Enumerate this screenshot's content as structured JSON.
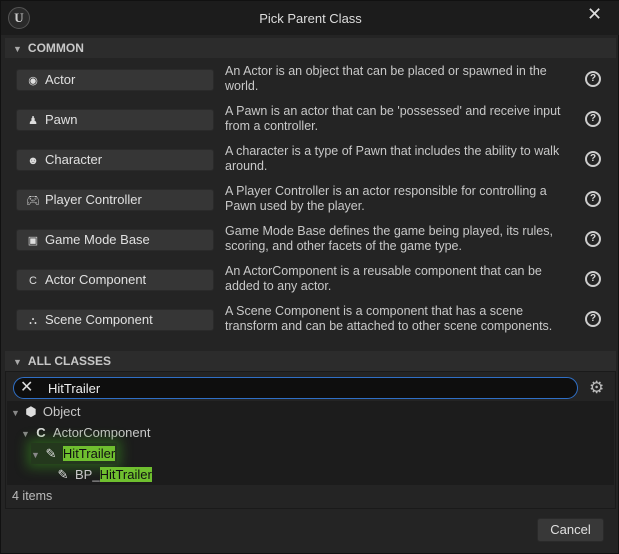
{
  "window": {
    "title": "Pick Parent Class",
    "close_icon": "close-icon",
    "logo": "unreal-logo"
  },
  "common": {
    "header": "COMMON",
    "items": [
      {
        "label": "Actor",
        "icon": "actor-icon",
        "desc": "An Actor is an object that can be placed or spawned in the world."
      },
      {
        "label": "Pawn",
        "icon": "pawn-icon",
        "desc": "A Pawn is an actor that can be 'possessed' and receive input from a controller."
      },
      {
        "label": "Character",
        "icon": "character-icon",
        "desc": "A character is a type of Pawn that includes the ability to walk around."
      },
      {
        "label": "Player Controller",
        "icon": "gamepad-icon",
        "desc": "A Player Controller is an actor responsible for controlling a Pawn used by the player."
      },
      {
        "label": "Game Mode Base",
        "icon": "game-mode-icon",
        "desc": "Game Mode Base defines the game being played, its rules, scoring, and other facets of the game type."
      },
      {
        "label": "Actor Component",
        "icon": "component-icon",
        "desc": "An ActorComponent is a reusable component that can be added to any actor."
      },
      {
        "label": "Scene Component",
        "icon": "scene-component-icon",
        "desc": "A Scene Component is a component that has a scene transform and can be attached to other scene components."
      }
    ]
  },
  "all_classes": {
    "header": "ALL CLASSES",
    "search_value": "HitTrailer",
    "tree": [
      {
        "label": "Object",
        "icon": "object-icon"
      },
      {
        "label": "ActorComponent",
        "icon": "component-icon"
      },
      {
        "label": "HitTrailer",
        "icon": "blueprint-icon",
        "selected": true
      },
      {
        "prefix": "BP_",
        "label": "HitTrailer",
        "icon": "blueprint-icon"
      }
    ],
    "count": "4 items"
  },
  "footer": {
    "cancel": "Cancel"
  },
  "colors": {
    "highlight": "#6fbf2f",
    "search_border": "#2f6fc6"
  }
}
